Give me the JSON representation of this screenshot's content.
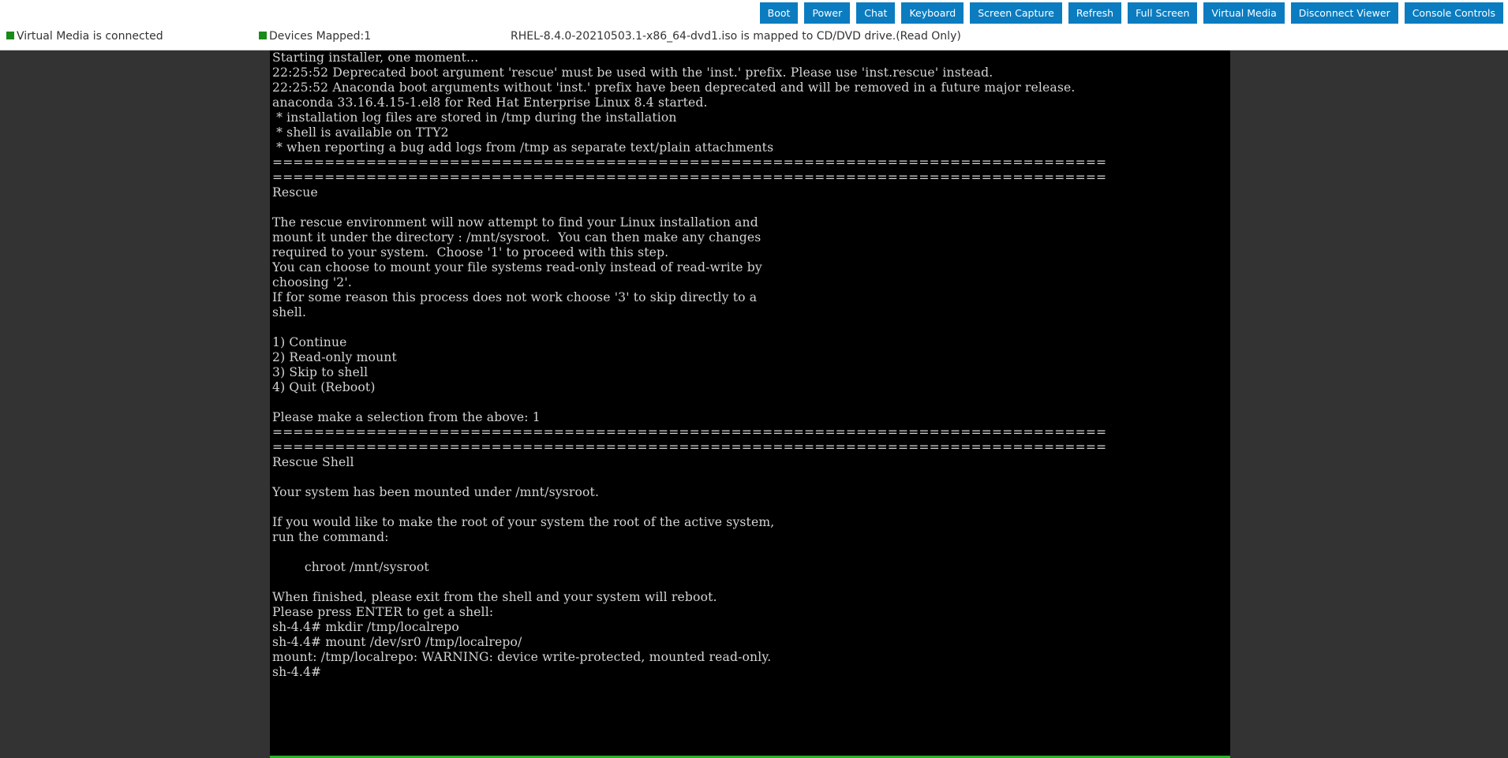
{
  "toolbar": {
    "buttons": [
      {
        "label": "Boot"
      },
      {
        "label": "Power"
      },
      {
        "label": "Chat"
      },
      {
        "label": "Keyboard"
      },
      {
        "label": "Screen Capture"
      },
      {
        "label": "Refresh"
      },
      {
        "label": "Full Screen"
      },
      {
        "label": "Virtual Media"
      },
      {
        "label": "Disconnect Viewer"
      },
      {
        "label": "Console Controls"
      }
    ]
  },
  "status": {
    "virtual_media": "Virtual Media is connected",
    "devices_mapped": "Devices Mapped:1",
    "iso_mapping": "RHEL-8.4.0-20210503.1-x86_64-dvd1.iso is mapped to CD/DVD drive.(Read Only)",
    "indicator_color": "#1a8a1a"
  },
  "console": {
    "lines": [
      "Starting installer, one moment...",
      "22:25:52 Deprecated boot argument 'rescue' must be used with the 'inst.' prefix. Please use 'inst.rescue' instead.",
      "22:25:52 Anaconda boot arguments without 'inst.' prefix have been deprecated and will be removed in a future major release.",
      "anaconda 33.16.4.15-1.el8 for Red Hat Enterprise Linux 8.4 started.",
      " * installation log files are stored in /tmp during the installation",
      " * shell is available on TTY2",
      " * when reporting a bug add logs from /tmp as separate text/plain attachments",
      "================================================================================",
      "================================================================================",
      "Rescue",
      "",
      "The rescue environment will now attempt to find your Linux installation and",
      "mount it under the directory : /mnt/sysroot.  You can then make any changes",
      "required to your system.  Choose '1' to proceed with this step.",
      "You can choose to mount your file systems read-only instead of read-write by",
      "choosing '2'.",
      "If for some reason this process does not work choose '3' to skip directly to a",
      "shell.",
      "",
      "1) Continue",
      "2) Read-only mount",
      "3) Skip to shell",
      "4) Quit (Reboot)",
      "",
      "Please make a selection from the above: 1",
      "================================================================================",
      "================================================================================",
      "Rescue Shell",
      "",
      "Your system has been mounted under /mnt/sysroot.",
      "",
      "If you would like to make the root of your system the root of the active system,",
      "run the command:",
      "",
      "        chroot /mnt/sysroot",
      "",
      "When finished, please exit from the shell and your system will reboot.",
      "Please press ENTER to get a shell:",
      "sh-4.4# mkdir /tmp/localrepo",
      "sh-4.4# mount /dev/sr0 /tmp/localrepo/",
      "mount: /tmp/localrepo: WARNING: device write-protected, mounted read-only.",
      "sh-4.4#"
    ]
  }
}
